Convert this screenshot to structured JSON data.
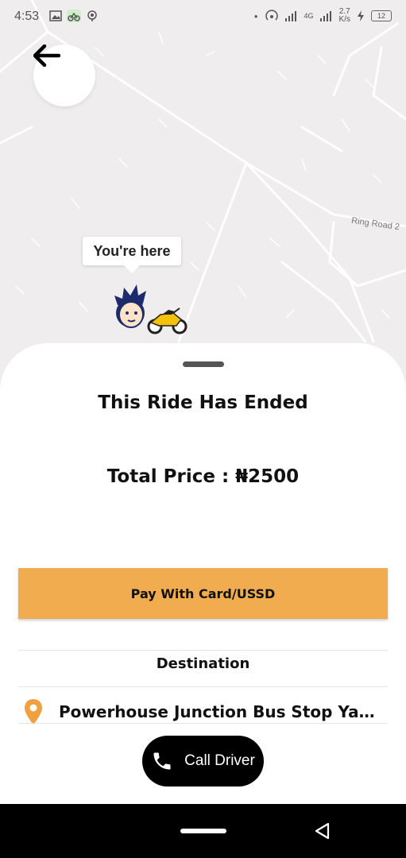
{
  "status_bar": {
    "time": "4:53",
    "network_type": "4G",
    "speed_value": "2.7",
    "speed_unit": "K/s",
    "battery_level": "12"
  },
  "map": {
    "road_label": "Ring Road 2",
    "tooltip": "You're here",
    "icons": [
      "back-arrow-icon",
      "driver-avatar-icon",
      "motorbike-icon"
    ]
  },
  "sheet": {
    "title": "This Ride Has Ended",
    "price_text": "Total Price : ₦2500",
    "pay_button": "Pay With Card/USSD",
    "destination_label": "Destination",
    "destination_value": "Powerhouse Junction Bus Stop Yaba, Lagos",
    "call_button": "Call Driver"
  },
  "colors": {
    "accent": "#f0ac4e",
    "pin": "#f0a03c",
    "map_bg": "#efedee",
    "call_button_bg": "#000000"
  }
}
